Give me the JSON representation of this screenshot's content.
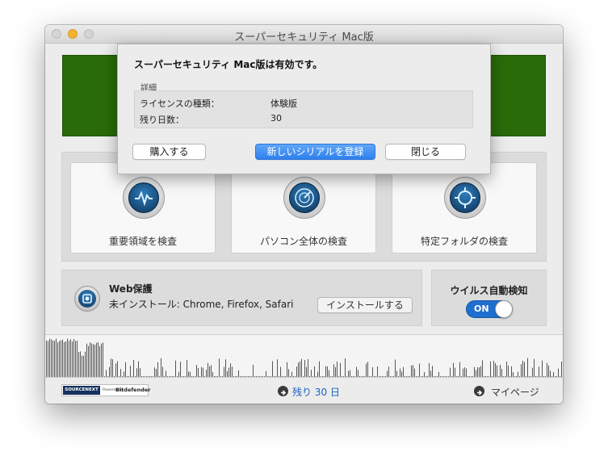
{
  "window": {
    "title": "スーパーセキュリティ Mac版"
  },
  "colors": {
    "banner": "#2a6b09",
    "accent": "#2f80ee",
    "toggle_on": "#1e6fcf"
  },
  "scan": {
    "cards": [
      {
        "label": "重要領域を検査",
        "icon": "pulse-icon"
      },
      {
        "label": "パソコン全体の検査",
        "icon": "radar-icon"
      },
      {
        "label": "特定フォルダの検査",
        "icon": "crosshair-icon"
      }
    ]
  },
  "web_protection": {
    "title": "Web保護",
    "status": "未インストール: Chrome, Firefox, Safari",
    "install_label": "インストールする"
  },
  "auto_scan": {
    "title": "ウイルス自動検知",
    "toggle_label": "ON",
    "enabled": true
  },
  "footer": {
    "logo_sourcenext": "SOURCENEXT",
    "logo_powered": "Powered by",
    "logo_bitdefender": "Bitdefender",
    "days_remaining": "残り 30 日",
    "mypage": "マイページ"
  },
  "dialog": {
    "title": "スーパーセキュリティ Mac版は有効です。",
    "details_label": "詳細",
    "license_type_label": "ライセンスの種類：",
    "license_type_value": "体験版",
    "days_left_label": "残り日数：",
    "days_left_value": "30",
    "buy_label": "購入する",
    "register_label": "新しいシリアルを登録",
    "close_label": "閉じる"
  }
}
